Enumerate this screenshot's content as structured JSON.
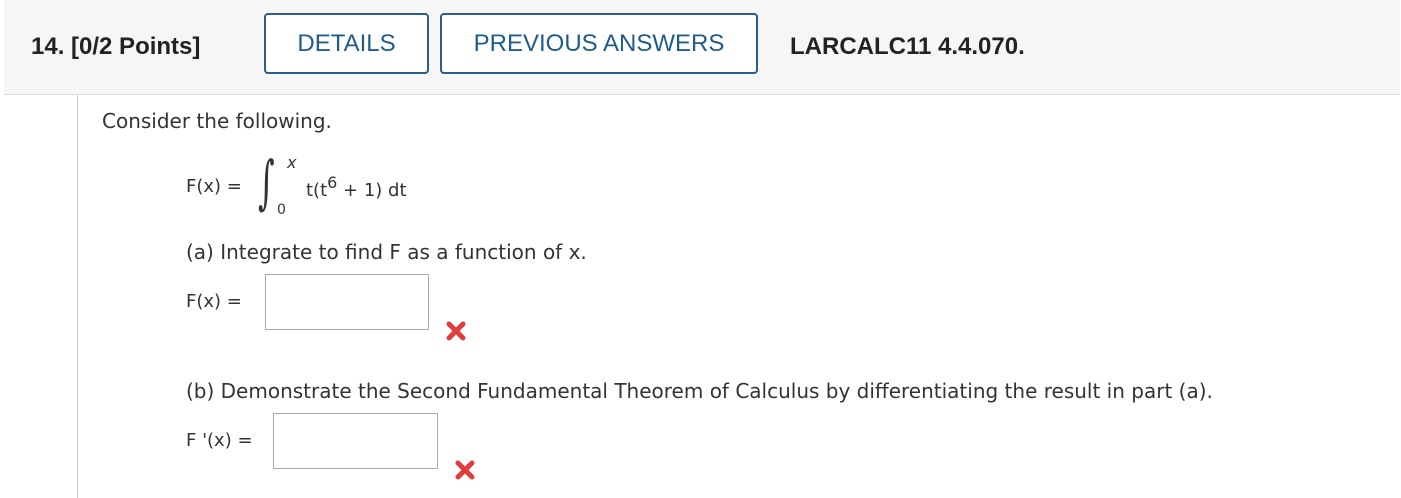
{
  "header": {
    "question": "14. [0/2 Points]",
    "details_label": "DETAILS",
    "previous_answers_label": "PREVIOUS ANSWERS",
    "course_code": "LARCALC11 4.4.070."
  },
  "problem": {
    "prompt": "Consider the following.",
    "function_lhs": "F(x) =",
    "upper_limit": "x",
    "lower_limit": "0",
    "integrand_start": "t(t",
    "integrand_exponent": "6",
    "integrand_end": " + 1) dt"
  },
  "part_a": {
    "instruction": "(a) Integrate to find F as a function of x.",
    "answer_label": "F(x) =",
    "answer_value": "",
    "status": "incorrect"
  },
  "part_b": {
    "instruction": "(b) Demonstrate the Second Fundamental Theorem of Calculus by differentiating the result in part (a).",
    "answer_label": "F '(x) =",
    "answer_value": "",
    "status": "incorrect"
  },
  "colors": {
    "accent": "#1f5c8c",
    "incorrect": "#e03c3c",
    "header_bg": "#f6f6f6"
  }
}
